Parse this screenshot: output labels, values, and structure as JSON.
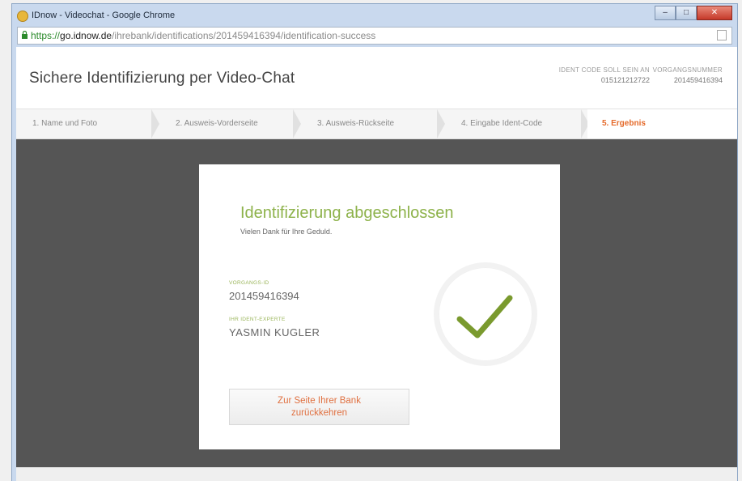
{
  "browser": {
    "window_title": "IDnow - Videochat - Google Chrome",
    "url_scheme": "https://",
    "url_host": "go.idnow.de",
    "url_path": "/ihrebank/identifications/201459416394/identification-success",
    "controls": {
      "minimize": "–",
      "maximize": "□",
      "close": "✕"
    }
  },
  "header": {
    "title": "Sichere Identifizierung per Video-Chat",
    "ident_code_label": "IDENT CODE SOLL SEIN AN",
    "ident_code_value": "015121212722",
    "vorgang_label": "VORGANGSNUMMER",
    "vorgang_value": "201459416394"
  },
  "steps": [
    {
      "label": "1. Name und Foto"
    },
    {
      "label": "2. Ausweis-Vorderseite"
    },
    {
      "label": "3. Ausweis-Rückseite"
    },
    {
      "label": "4. Eingabe Ident-Code"
    },
    {
      "label": "5. Ergebnis"
    }
  ],
  "card": {
    "heading": "Identifizierung abgeschlossen",
    "subtext": "Vielen Dank für Ihre Geduld.",
    "vorgang_label": "VORGANGS-ID",
    "vorgang_value": "201459416394",
    "experte_label": "IHR IDENT-EXPERTE",
    "experte_value": "YASMIN KUGLER",
    "button_line1": "Zur Seite Ihrer Bank",
    "button_line2": "zurückkehren"
  },
  "colors": {
    "accent_green": "#8db24a",
    "accent_orange": "#e56a2a",
    "backdrop": "#555555"
  }
}
